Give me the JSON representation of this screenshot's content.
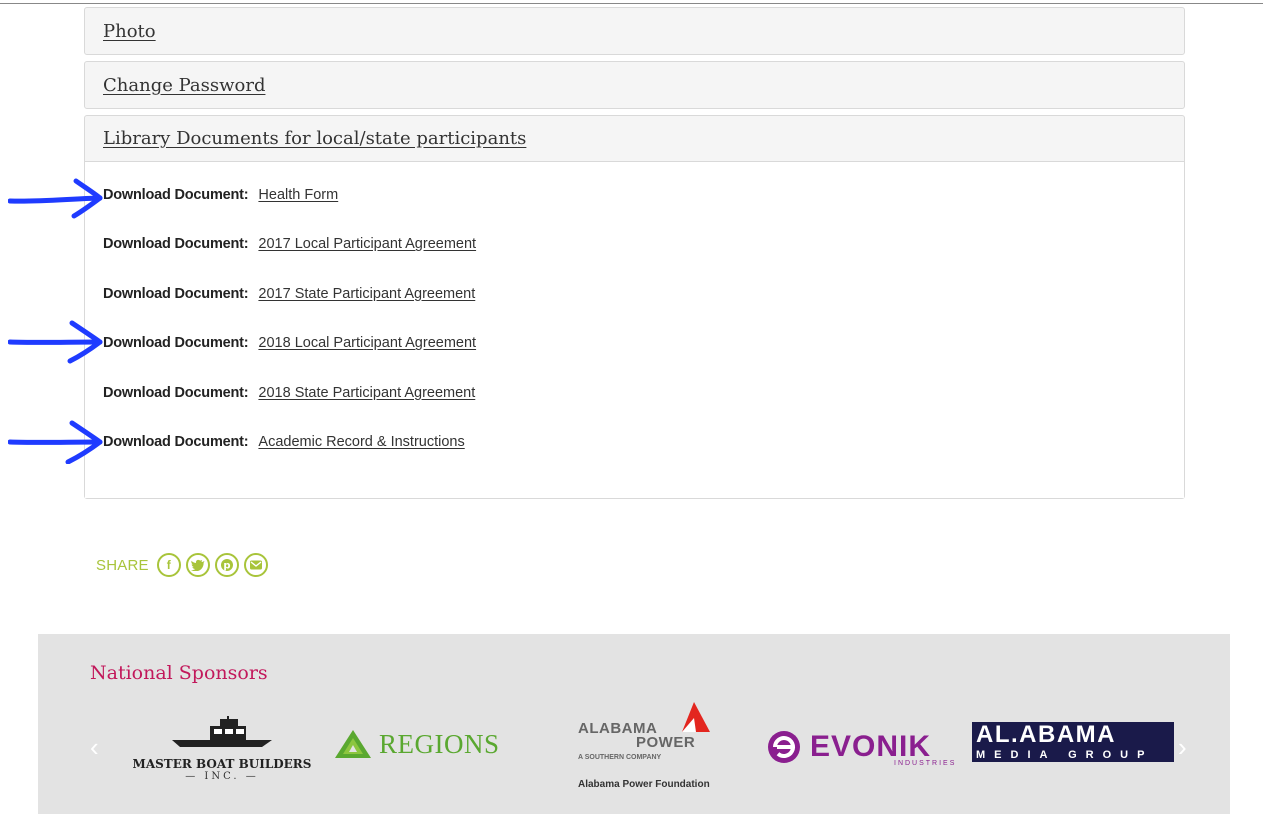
{
  "panels": {
    "photo": "Photo",
    "change_password": "Change Password",
    "library": "Library Documents for local/state participants"
  },
  "documents": {
    "label": "Download Document:",
    "items": [
      "Health Form",
      "2017 Local Participant Agreement",
      "2017 State Participant Agreement",
      "2018 Local Participant Agreement",
      "2018 State Participant Agreement",
      "Academic Record & Instructions"
    ]
  },
  "share": {
    "label": "SHARE",
    "icons": [
      "facebook-icon",
      "twitter-icon",
      "pinterest-icon",
      "email-icon"
    ]
  },
  "footer": {
    "title": "National Sponsors",
    "prev": "‹",
    "next": "›",
    "sponsors": {
      "master_boat": {
        "name": "MASTER BOAT BUILDERS",
        "sub": "— INC. —"
      },
      "regions": {
        "name": "REGIONS"
      },
      "alabama_power": {
        "line1": "ALABAMA",
        "line2": "POWER",
        "tagline": "A SOUTHERN COMPANY",
        "foundation": "Alabama Power Foundation"
      },
      "evonik": {
        "name": "EVONIK",
        "sub": "INDUSTRIES"
      },
      "alabama_media": {
        "name": "AL.ABAMA",
        "sub": "MEDIA GROUP"
      }
    }
  },
  "colors": {
    "share_green": "#a8c43a",
    "sponsor_title": "#c2185b",
    "arrow_blue": "#1f3bff"
  }
}
